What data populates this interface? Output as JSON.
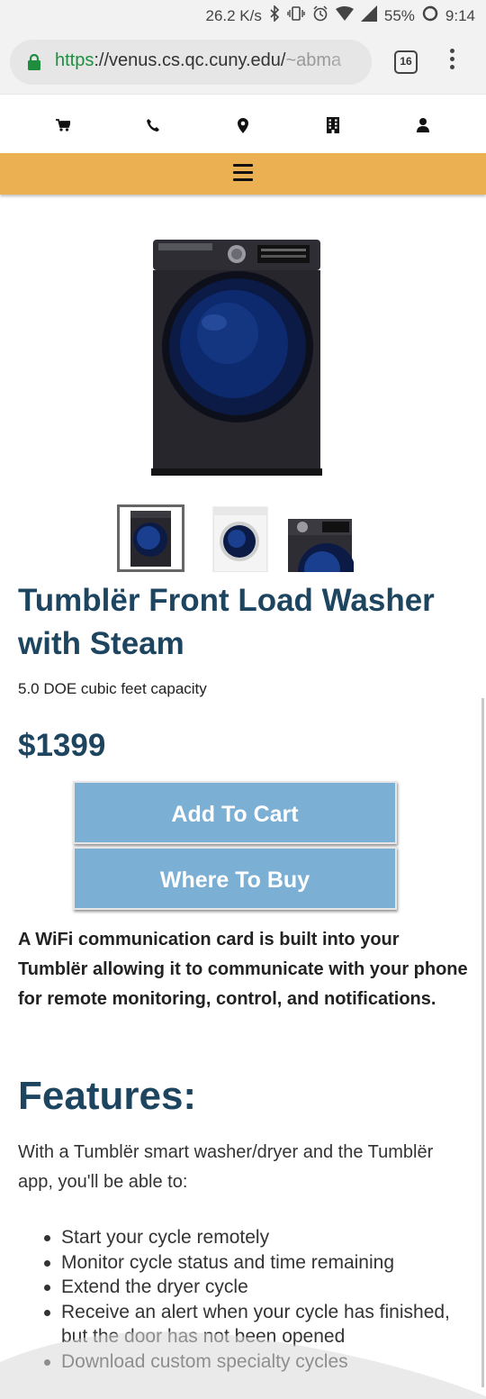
{
  "status_bar": {
    "speed": "26.2 K/s",
    "battery": "55%",
    "time": "9:14"
  },
  "browser": {
    "url_scheme": "https",
    "url_host": "://venus.cs.qc.cuny.edu/",
    "url_path": "~abma",
    "tab_count": "16"
  },
  "nav": {
    "icons": [
      "cart-icon",
      "phone-icon",
      "map-pin-icon",
      "building-icon",
      "user-icon"
    ],
    "menu_color": "#eab052"
  },
  "product": {
    "title": "Tumblër Front Load Washer with Steam",
    "capacity": "5.0 DOE cubic feet capacity",
    "price": "$1399",
    "add_to_cart": "Add To Cart",
    "where_to_buy": "Where To Buy",
    "description": "A WiFi communication card is built into your Tumblër allowing it to communicate with your phone for remote monitoring, control, and notifications."
  },
  "features": {
    "heading": "Features:",
    "intro": "With a Tumblër smart washer/dryer and the Tumblër app, you'll be able to:",
    "items": [
      "Start your cycle remotely",
      "Monitor cycle status and time remaining",
      "Extend the dryer cycle",
      "Receive an alert when your cycle has finished, but the door has not been opened",
      "Download custom specialty cycles"
    ]
  },
  "colors": {
    "heading": "#1d4560",
    "button": "#7bafd4"
  }
}
